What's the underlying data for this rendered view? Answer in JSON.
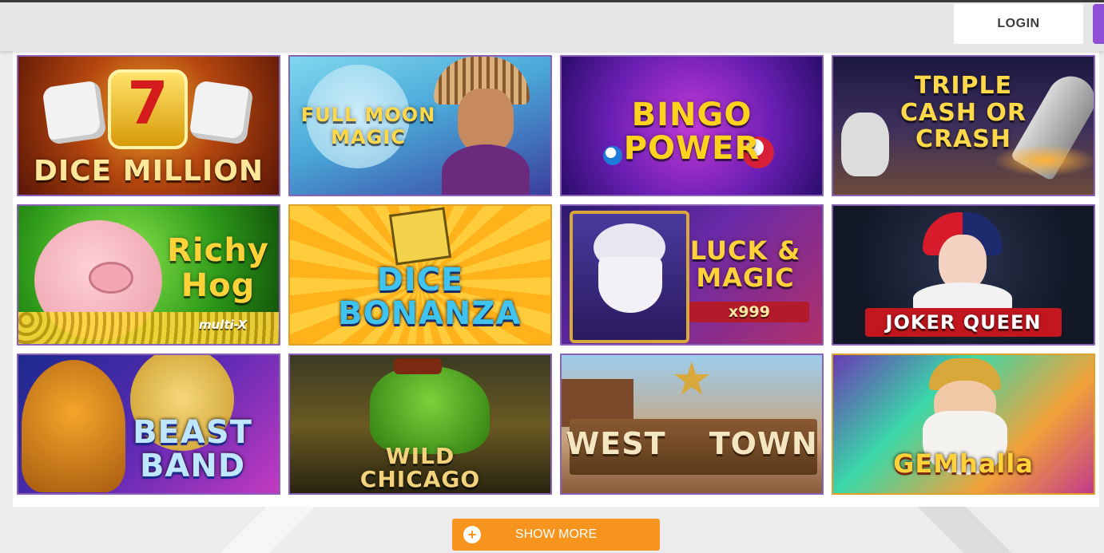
{
  "header": {
    "login_label": "LOGIN"
  },
  "games": [
    {
      "title": "DICE MILLION",
      "subtitle": ""
    },
    {
      "title": "FULL MOON MAGIC",
      "subtitle": ""
    },
    {
      "title": "BINGO POWER",
      "subtitle": ""
    },
    {
      "title": "TRIPLE CASH OR CRASH",
      "subtitle": ""
    },
    {
      "title": "Richy Hog",
      "subtitle": "multi-X"
    },
    {
      "title": "DICE BONANZA",
      "subtitle": ""
    },
    {
      "title": "LUCK & MAGIC",
      "subtitle": "x999"
    },
    {
      "title": "JOKER QUEEN",
      "subtitle": ""
    },
    {
      "title": "BEAST BAND",
      "subtitle": ""
    },
    {
      "title": "WILD CHICAGO",
      "subtitle": ""
    },
    {
      "title": "WEST TOWN",
      "subtitle": ""
    },
    {
      "title": "GEMhalla",
      "subtitle": ""
    }
  ],
  "footer": {
    "show_more_label": "SHOW MORE"
  },
  "colors": {
    "accent": "#f7941d",
    "tile_border": "#8a62b8",
    "register": "#8e4fd6"
  }
}
